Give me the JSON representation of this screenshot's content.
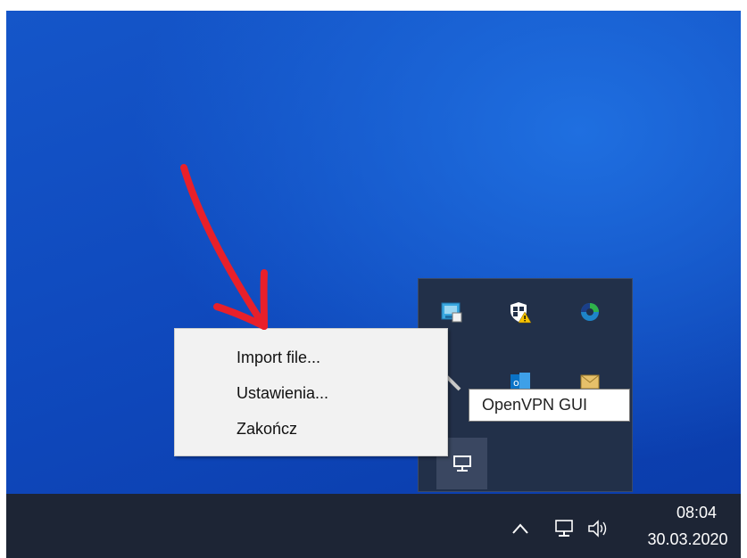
{
  "context_menu": {
    "items": [
      "Import file...",
      "Ustawienia...",
      "Zakończ"
    ]
  },
  "tooltip": {
    "text": "OpenVPN GUI"
  },
  "tray_flyout": {
    "icons": [
      "network-adapter-icon",
      "windows-security-icon",
      "colored-swirl-app-icon",
      "outlook-icon",
      "mail-envelope-icon",
      "openvpn-monitor-icon"
    ]
  },
  "taskbar": {
    "icons": [
      "chevron-up-icon",
      "network-icon",
      "volume-icon"
    ],
    "clock": {
      "time": "08:04",
      "date": "30.03.2020"
    }
  },
  "annotation": {
    "arrow_color": "#e8202a"
  }
}
